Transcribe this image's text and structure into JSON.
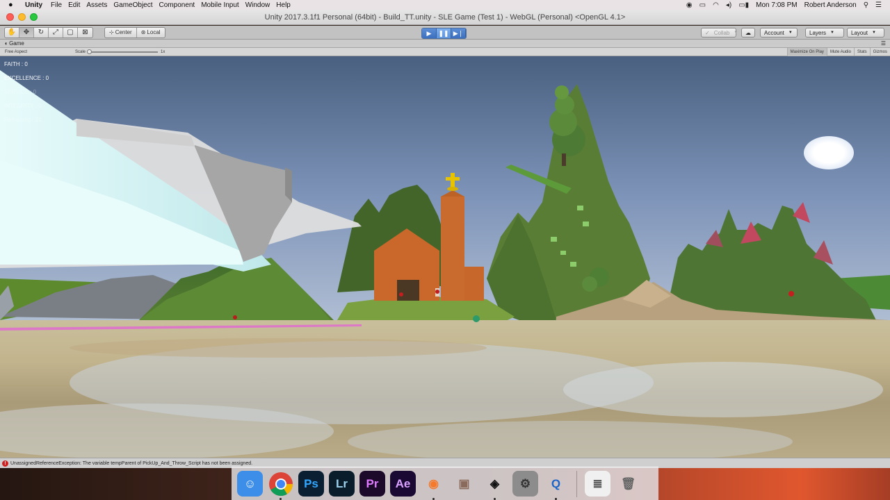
{
  "menubar": {
    "app_name": "Unity",
    "items": [
      "File",
      "Edit",
      "Assets",
      "GameObject",
      "Component",
      "Mobile Input",
      "Window",
      "Help"
    ],
    "clock": "Mon 7:08 PM",
    "user": "Robert Anderson"
  },
  "window": {
    "title": "Unity 2017.3.1f1 Personal (64bit) - Build_TT.unity - SLE Game (Test 1) - WebGL (Personal) <OpenGL 4.1>"
  },
  "toolbar": {
    "pivot_label": "Center",
    "space_label": "Local",
    "collab_label": "Collab",
    "account_label": "Account",
    "layers_label": "Layers",
    "layout_label": "Layout"
  },
  "game_view": {
    "tab_label": "Game",
    "aspect": "Free Aspect",
    "scale_label": "Scale",
    "scale_value": "1x",
    "scale_level": 0,
    "options": {
      "maximize": "Maximize On Play",
      "mute": "Mute Audio",
      "stats": "Stats",
      "gizmos": "Gizmos"
    }
  },
  "hud": {
    "faith": "FAITH : 0",
    "excellence": "EXCELLENCE : 0",
    "service": "SERVICE : 0",
    "integrity": "INTEGRITY : 0",
    "remaining": "Remaining : 21"
  },
  "console": {
    "message": "UnassignedReferenceException: The variable tempParent of PickUp_And_Throw_Script has not been assigned."
  },
  "dock": {
    "apps": [
      {
        "name": "Finder",
        "glyph": "☺",
        "bg": "#3d8ee8",
        "fg": "#ffffff"
      },
      {
        "name": "Chrome",
        "glyph": "",
        "bg": "transparent",
        "fg": "#ffffff"
      },
      {
        "name": "Photoshop",
        "glyph": "Ps",
        "bg": "#0b1f33",
        "fg": "#31a8ff"
      },
      {
        "name": "Lightroom",
        "glyph": "Lr",
        "bg": "#0a1d2b",
        "fg": "#9ed3ef"
      },
      {
        "name": "Premiere",
        "glyph": "Pr",
        "bg": "#1d0a2b",
        "fg": "#e07aff"
      },
      {
        "name": "After Effects",
        "glyph": "Ae",
        "bg": "#1a0a33",
        "fg": "#d9a3ff"
      },
      {
        "name": "Blender",
        "glyph": "◉",
        "bg": "transparent",
        "fg": "#f5792a"
      },
      {
        "name": "Toolbox",
        "glyph": "▣",
        "bg": "transparent",
        "fg": "#8a6a5a"
      },
      {
        "name": "Unity",
        "glyph": "◈",
        "bg": "transparent",
        "fg": "#111111"
      },
      {
        "name": "System Preferences",
        "glyph": "⚙",
        "bg": "#8c8c8c",
        "fg": "#333333"
      },
      {
        "name": "QuickTime",
        "glyph": "Q",
        "bg": "transparent",
        "fg": "#1b64c8"
      },
      {
        "name": "Document",
        "glyph": "≣",
        "bg": "#f0f0f0",
        "fg": "#555555"
      },
      {
        "name": "Trash",
        "glyph": "🗑",
        "bg": "transparent",
        "fg": "#666666"
      }
    ]
  }
}
